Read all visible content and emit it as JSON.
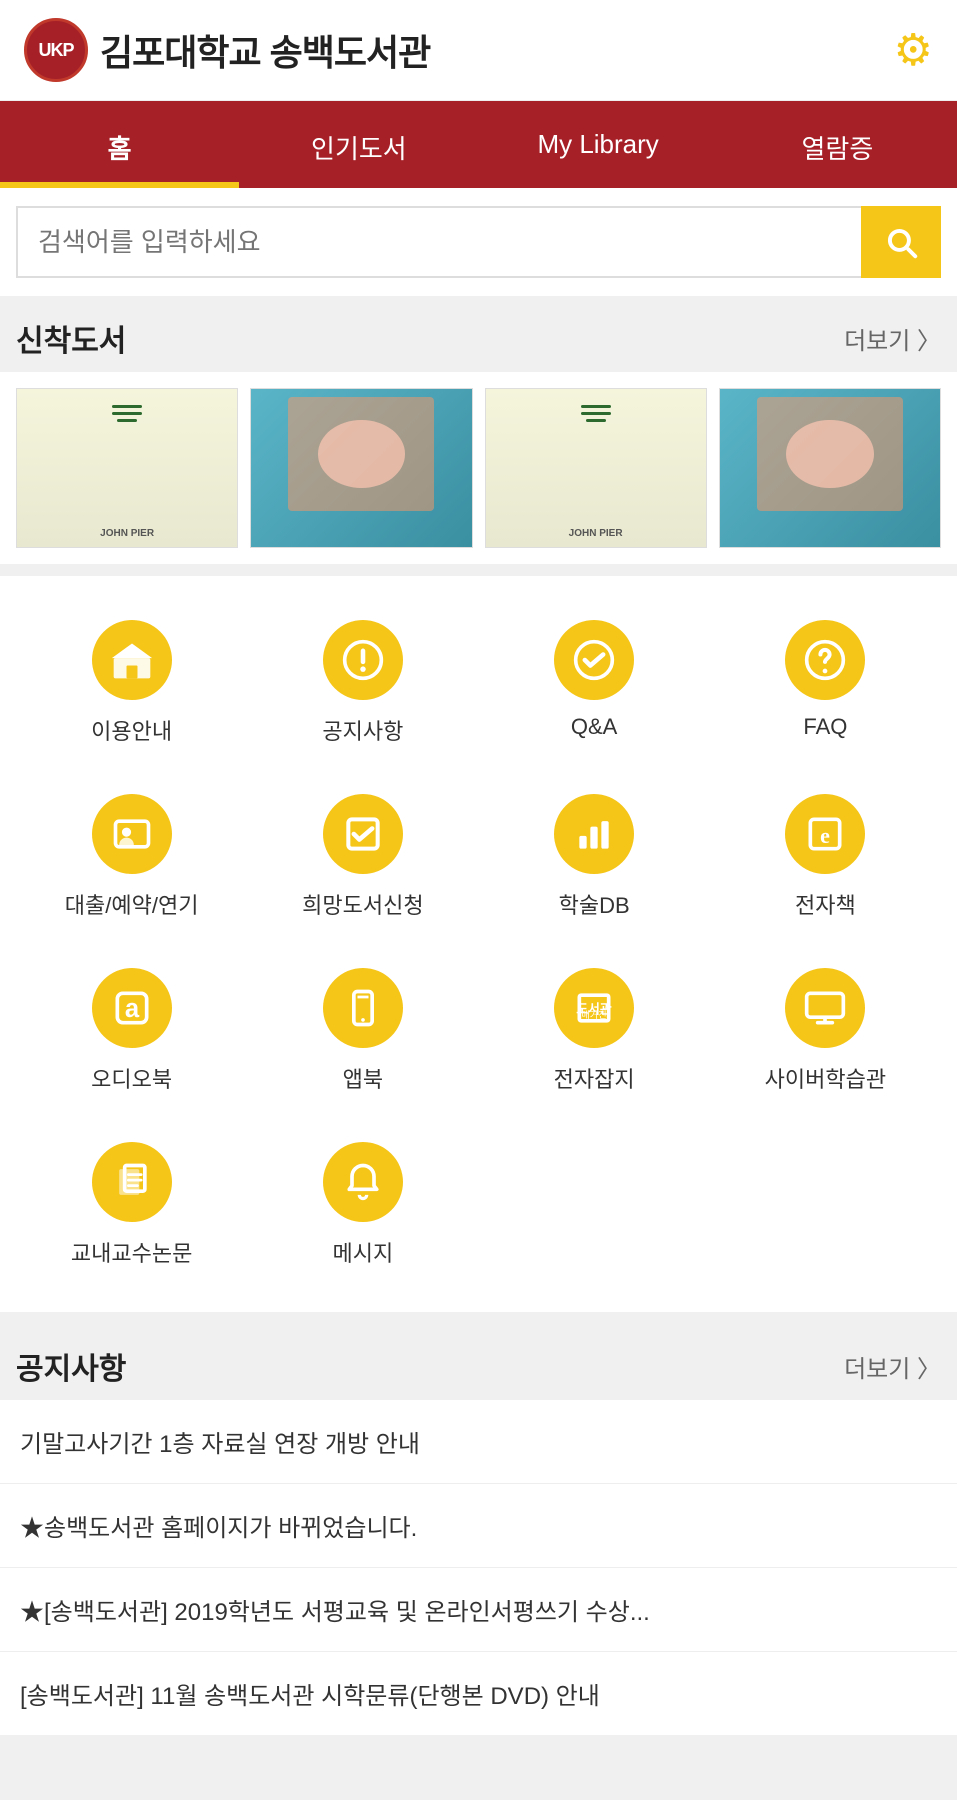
{
  "header": {
    "logo_abbr": "UKP",
    "logo_name": "김포대학교 송백도서관",
    "gear_icon": "⚙"
  },
  "nav": {
    "items": [
      {
        "label": "홈",
        "active": true
      },
      {
        "label": "인기도서",
        "active": false
      },
      {
        "label": "My Library",
        "active": false
      },
      {
        "label": "열람증",
        "active": false
      }
    ]
  },
  "search": {
    "placeholder": "검색어를 입력하세요",
    "button_label": "검색"
  },
  "new_books": {
    "title": "신착도서",
    "more_label": "더보기 〉",
    "books": [
      {
        "id": 1,
        "style": "1"
      },
      {
        "id": 2,
        "style": "2"
      },
      {
        "id": 3,
        "style": "3"
      },
      {
        "id": 4,
        "style": "4"
      }
    ]
  },
  "icons": [
    {
      "id": "library-info",
      "label": "이용안내",
      "icon_type": "building"
    },
    {
      "id": "notice",
      "label": "공지사항",
      "icon_type": "exclamation"
    },
    {
      "id": "qna",
      "label": "Q&A",
      "icon_type": "check-circle"
    },
    {
      "id": "faq",
      "label": "FAQ",
      "icon_type": "question"
    },
    {
      "id": "loan",
      "label": "대출/예약/연기",
      "icon_type": "card"
    },
    {
      "id": "wishbook",
      "label": "희망도서신청",
      "icon_type": "checkbox"
    },
    {
      "id": "academicdb",
      "label": "학술DB",
      "icon_type": "chart"
    },
    {
      "id": "ebook",
      "label": "전자책",
      "icon_type": "ebook"
    },
    {
      "id": "audiobook",
      "label": "오디오북",
      "icon_type": "audio"
    },
    {
      "id": "appbook",
      "label": "앱북",
      "icon_type": "tablet"
    },
    {
      "id": "emagazine",
      "label": "전자잡지",
      "icon_type": "magazine"
    },
    {
      "id": "cyberlearning",
      "label": "사이버학습관",
      "icon_type": "monitor"
    },
    {
      "id": "thesis",
      "label": "교내교수논문",
      "icon_type": "papers"
    },
    {
      "id": "message",
      "label": "메시지",
      "icon_type": "bell"
    }
  ],
  "notice": {
    "title": "공지사항",
    "more_label": "더보기 〉",
    "items": [
      {
        "text": "기말고사기간 1층 자료실 연장 개방 안내"
      },
      {
        "text": "★송백도서관 홈페이지가 바뀌었습니다."
      },
      {
        "text": "★[송백도서관] 2019학년도 서평교육 및 온라인서평쓰기 수상..."
      },
      {
        "text": "[송백도서관] 11월 송백도서관 시학문류(단행본 DVD) 안내"
      }
    ]
  }
}
